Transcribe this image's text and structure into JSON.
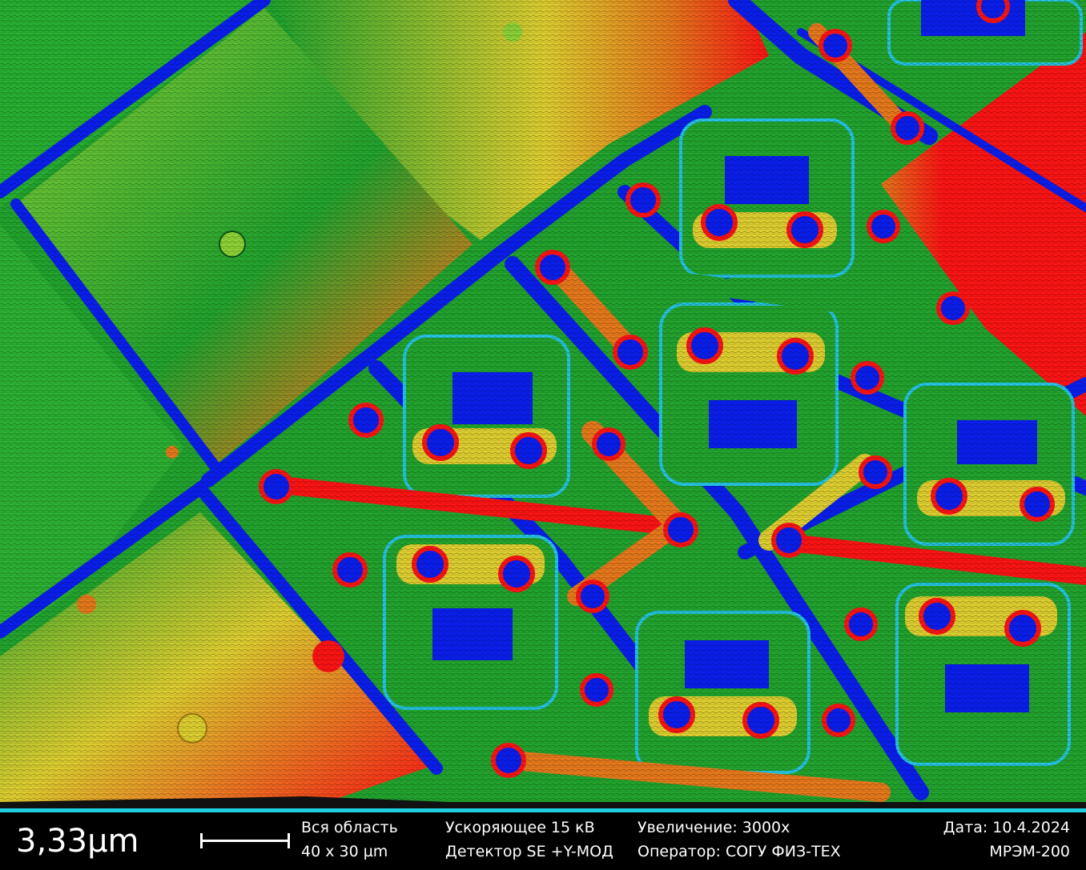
{
  "image": {
    "description_free_palette": {
      "base": "#22a52e",
      "light": "#8fd437",
      "yellow": "#e0d030",
      "orange": "#e87a1c",
      "red": "#ff1414",
      "blue": "#0a1ff0",
      "cyan": "#25c6e6"
    }
  },
  "info_bar": {
    "scale_value": "3,33µm",
    "field_label": "Вся область",
    "field_value": "40 x 30 µm",
    "voltage": "Ускоряющее 15 кВ",
    "detector": "Детектор SE +Y-МОД",
    "magnification": "Увеличение: 3000x",
    "operator": "Оператор: СОГУ ФИЗ-ТЕХ",
    "date": "Дата: 10.4.2024",
    "device": "МРЭМ-200"
  }
}
